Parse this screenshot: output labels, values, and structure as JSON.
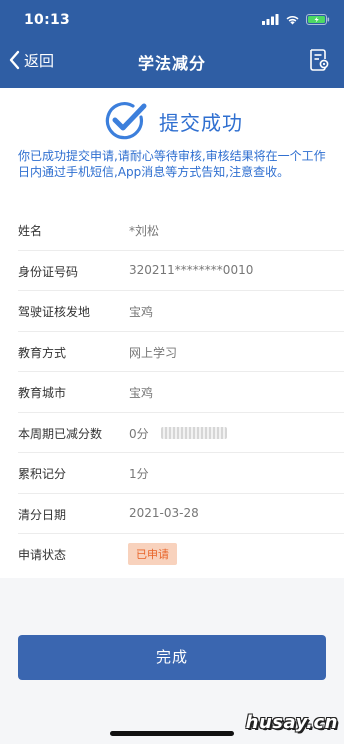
{
  "status_bar": {
    "time": "10:13"
  },
  "nav": {
    "back_label": "返回",
    "title": "学法减分"
  },
  "success": {
    "title": "提交成功",
    "message": "你已成功提交申请,请耐心等待审核,审核结果将在一个工作日内通过手机短信,App消息等方式告知,注意查收。"
  },
  "details": [
    {
      "label": "姓名",
      "value": "*刘松"
    },
    {
      "label": "身份证号码",
      "value": "320211********0010"
    },
    {
      "label": "驾驶证核发地",
      "value": "宝鸡"
    },
    {
      "label": "教育方式",
      "value": "网上学习"
    },
    {
      "label": "教育城市",
      "value": "宝鸡"
    },
    {
      "label": "本周期已减分数",
      "value": "0分"
    },
    {
      "label": "累积记分",
      "value": "1分"
    },
    {
      "label": "清分日期",
      "value": "2021-03-28"
    },
    {
      "label": "申请状态",
      "value": "已申请"
    }
  ],
  "done_button": "完成",
  "watermark": "husay.cn",
  "colors": {
    "primary": "#2f5ea4",
    "accent_text": "#2f6fd0",
    "status_tag_bg": "#f8d2bd",
    "status_tag_text": "#e8652a"
  },
  "icons": [
    "signal-icon",
    "wifi-icon",
    "battery-icon",
    "back-chevron-icon",
    "document-settings-icon",
    "check-circle-icon"
  ]
}
